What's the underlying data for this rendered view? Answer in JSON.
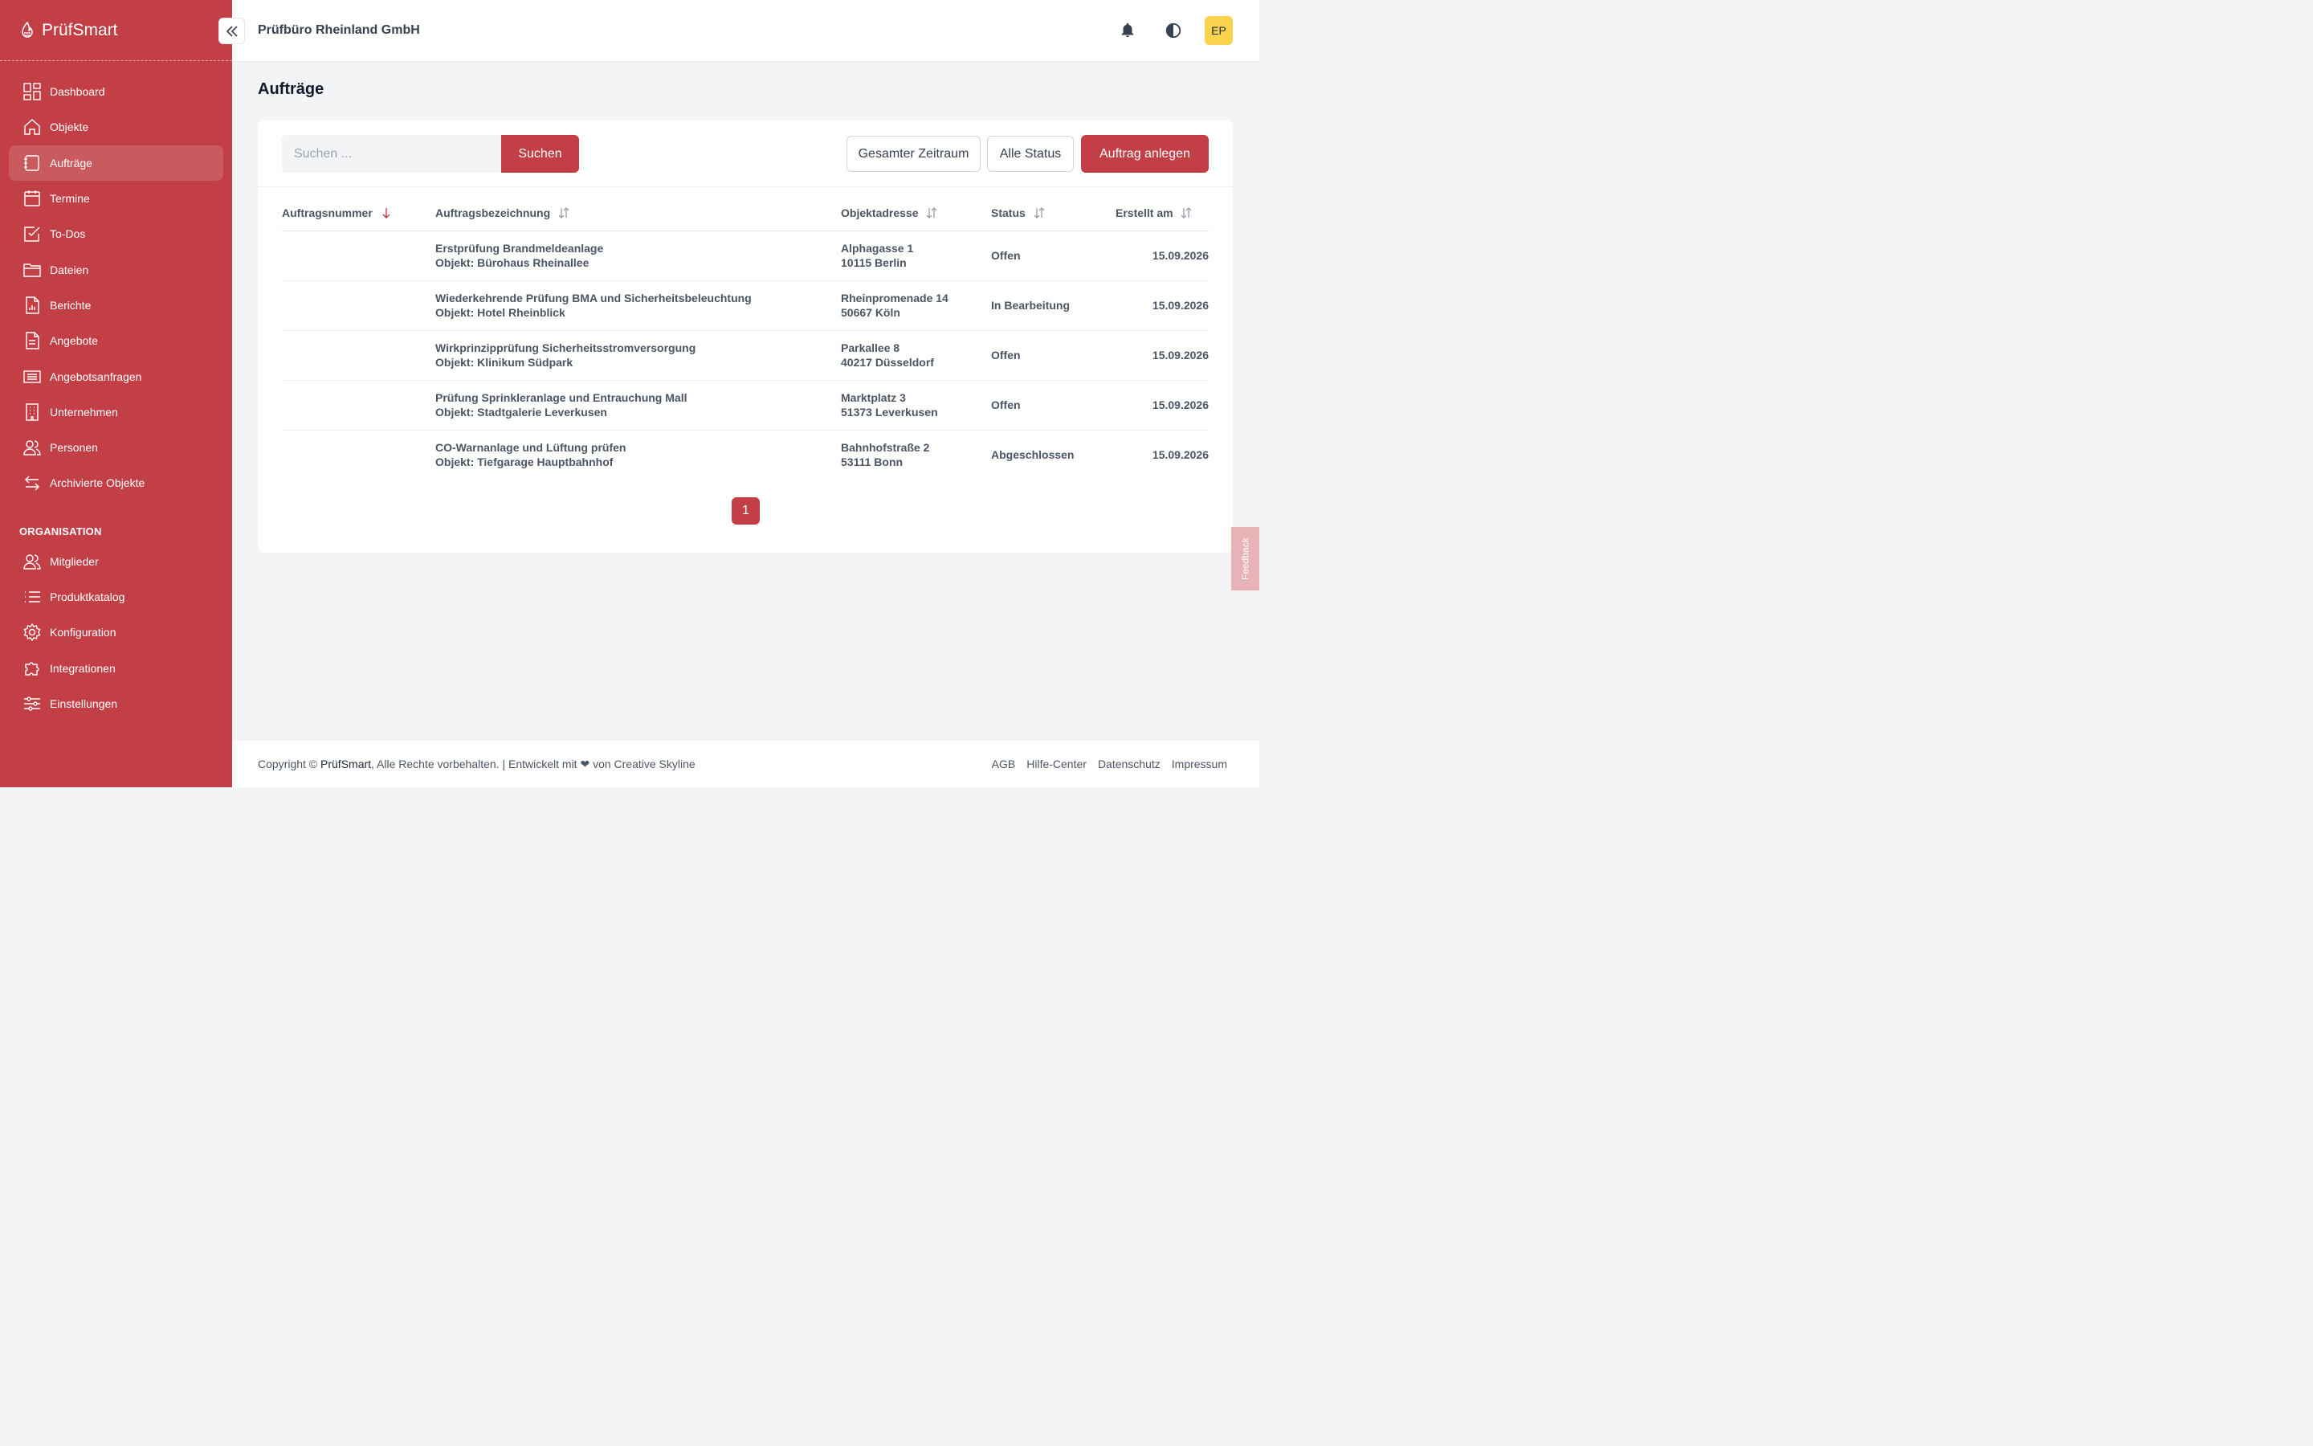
{
  "brand": {
    "name": "PrüfSmart"
  },
  "header": {
    "company": "Prüfbüro Rheinland GmbH",
    "avatar_initials": "EP"
  },
  "sidebar": {
    "items": [
      {
        "label": "Dashboard",
        "icon": "dashboard-icon"
      },
      {
        "label": "Objekte",
        "icon": "home-icon"
      },
      {
        "label": "Aufträge",
        "icon": "orders-icon",
        "active": true
      },
      {
        "label": "Termine",
        "icon": "calendar-icon"
      },
      {
        "label": "To-Dos",
        "icon": "checkbox-icon"
      },
      {
        "label": "Dateien",
        "icon": "folder-icon"
      },
      {
        "label": "Berichte",
        "icon": "report-icon"
      },
      {
        "label": "Angebote",
        "icon": "document-icon"
      },
      {
        "label": "Angebotsanfragen",
        "icon": "inbox-icon"
      },
      {
        "label": "Unternehmen",
        "icon": "building-icon"
      },
      {
        "label": "Personen",
        "icon": "people-icon"
      },
      {
        "label": "Archivierte Objekte",
        "icon": "archive-arrows-icon"
      }
    ],
    "section_title": "ORGANISATION",
    "org_items": [
      {
        "label": "Mitglieder",
        "icon": "members-icon"
      },
      {
        "label": "Produktkatalog",
        "icon": "list-icon"
      },
      {
        "label": "Konfiguration",
        "icon": "gear-icon"
      },
      {
        "label": "Integrationen",
        "icon": "puzzle-icon"
      },
      {
        "label": "Einstellungen",
        "icon": "sliders-icon"
      }
    ]
  },
  "main": {
    "title": "Aufträge",
    "search": {
      "placeholder": "Suchen ...",
      "button": "Suchen"
    },
    "filters": {
      "period": "Gesamter Zeitraum",
      "status": "Alle Status"
    },
    "create_button": "Auftrag anlegen",
    "table": {
      "headers": [
        "Auftragsnummer",
        "Auftragsbezeichnung",
        "Objektadresse",
        "Status",
        "Erstellt am"
      ],
      "rows": [
        {
          "number": "",
          "title": "Erstprüfung Brandmeldeanlage",
          "object": "Objekt: Bürohaus Rheinallee",
          "street": "Alphagasse 1",
          "city": "10115 Berlin",
          "status": "Offen",
          "date": "15.09.2026"
        },
        {
          "number": "",
          "title": "Wiederkehrende Prüfung BMA und Sicherheitsbeleuchtung",
          "object": "Objekt: Hotel Rheinblick",
          "street": "Rheinpromenade 14",
          "city": "50667 Köln",
          "status": "In Bearbeitung",
          "date": "15.09.2026"
        },
        {
          "number": "",
          "title": "Wirkprinzipprüfung Sicherheitsstromversorgung",
          "object": "Objekt: Klinikum Südpark",
          "street": "Parkallee 8",
          "city": "40217 Düsseldorf",
          "status": "Offen",
          "date": "15.09.2026"
        },
        {
          "number": "",
          "title": "Prüfung Sprinkleranlage und Entrauchung Mall",
          "object": "Objekt: Stadtgalerie Leverkusen",
          "street": "Marktplatz 3",
          "city": "51373 Leverkusen",
          "status": "Offen",
          "date": "15.09.2026"
        },
        {
          "number": "",
          "title": "CO-Warnanlage und Lüftung prüfen",
          "object": "Objekt: Tiefgarage Hauptbahnhof",
          "street": "Bahnhofstraße 2",
          "city": "53111 Bonn",
          "status": "Abgeschlossen",
          "date": "15.09.2026"
        }
      ]
    },
    "pagination": {
      "current": "1"
    }
  },
  "feedback_label": "Feedback",
  "footer": {
    "copyright_prefix": "Copyright ©",
    "brand": "PrüfSmart",
    "copyright_suffix": ", Alle Rechte vorbehalten. | Entwickelt mit ❤ von Creative Skyline",
    "links": [
      "AGB",
      "Hilfe-Center",
      "Datenschutz",
      "Impressum"
    ]
  },
  "colors": {
    "primary": "#c13f45",
    "avatar": "#fcd34d",
    "background": "#f3f4f6"
  }
}
